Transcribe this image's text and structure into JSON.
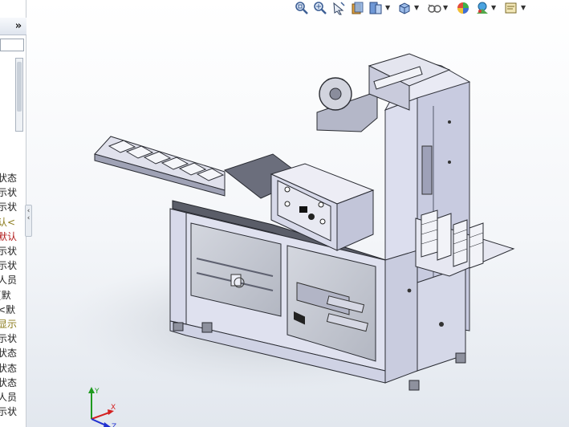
{
  "feature_tree": {
    "expand_glyph": "»",
    "items": [
      {
        "text": "状态",
        "color": "#222222"
      },
      {
        "text": "示状",
        "color": "#222222"
      },
      {
        "text": "示状",
        "color": "#222222"
      },
      {
        "text": "认<",
        "color": "#8a7a1a"
      },
      {
        "text": "默认",
        "color": "#b01818"
      },
      {
        "text": "示状",
        "color": "#222222"
      },
      {
        "text": "示状",
        "color": "#222222"
      },
      {
        "text": "人员",
        "color": "#222222"
      },
      {
        "text": "(默",
        "color": "#222222"
      },
      {
        "text": "<默",
        "color": "#222222"
      },
      {
        "text": "显示",
        "color": "#8a7a1a"
      },
      {
        "text": "示状",
        "color": "#222222"
      },
      {
        "text": "状态",
        "color": "#222222"
      },
      {
        "text": "状态",
        "color": "#222222"
      },
      {
        "text": "状态",
        "color": "#222222"
      },
      {
        "text": "人员",
        "color": "#222222"
      },
      {
        "text": "示状",
        "color": "#222222"
      }
    ],
    "splitter_glyphs": [
      "‹",
      "‹"
    ]
  },
  "toolbar": {
    "buttons": [
      {
        "icon": "zoom-to-fit-icon"
      },
      {
        "icon": "zoom-to-area-icon"
      },
      {
        "icon": "previous-view-icon"
      },
      {
        "icon": "section-view-icon"
      },
      {
        "icon": "view-orientation-icon",
        "has_dropdown": true
      },
      {
        "icon": "display-style-icon",
        "has_dropdown": true
      },
      {
        "icon": "hide-show-items-icon",
        "has_dropdown": true
      },
      {
        "icon": "edit-appearance-icon",
        "has_dropdown": false
      },
      {
        "icon": "apply-scene-icon",
        "has_dropdown": true
      },
      {
        "icon": "view-settings-icon",
        "has_dropdown": true
      }
    ],
    "dropdown_glyph": "▼"
  },
  "viewport": {
    "panel_colors": {
      "frame": "#d5d7e8",
      "frame_dark": "#a9acc4",
      "glass": "#c4c8d2",
      "metal": "#d9dbe4",
      "dark": "#3a3d46"
    }
  },
  "triad": {
    "x_label": "X",
    "y_label": "Y",
    "z_label": "Z",
    "x_color": "#d42020",
    "y_color": "#1f9a1f",
    "z_color": "#2030d0"
  }
}
